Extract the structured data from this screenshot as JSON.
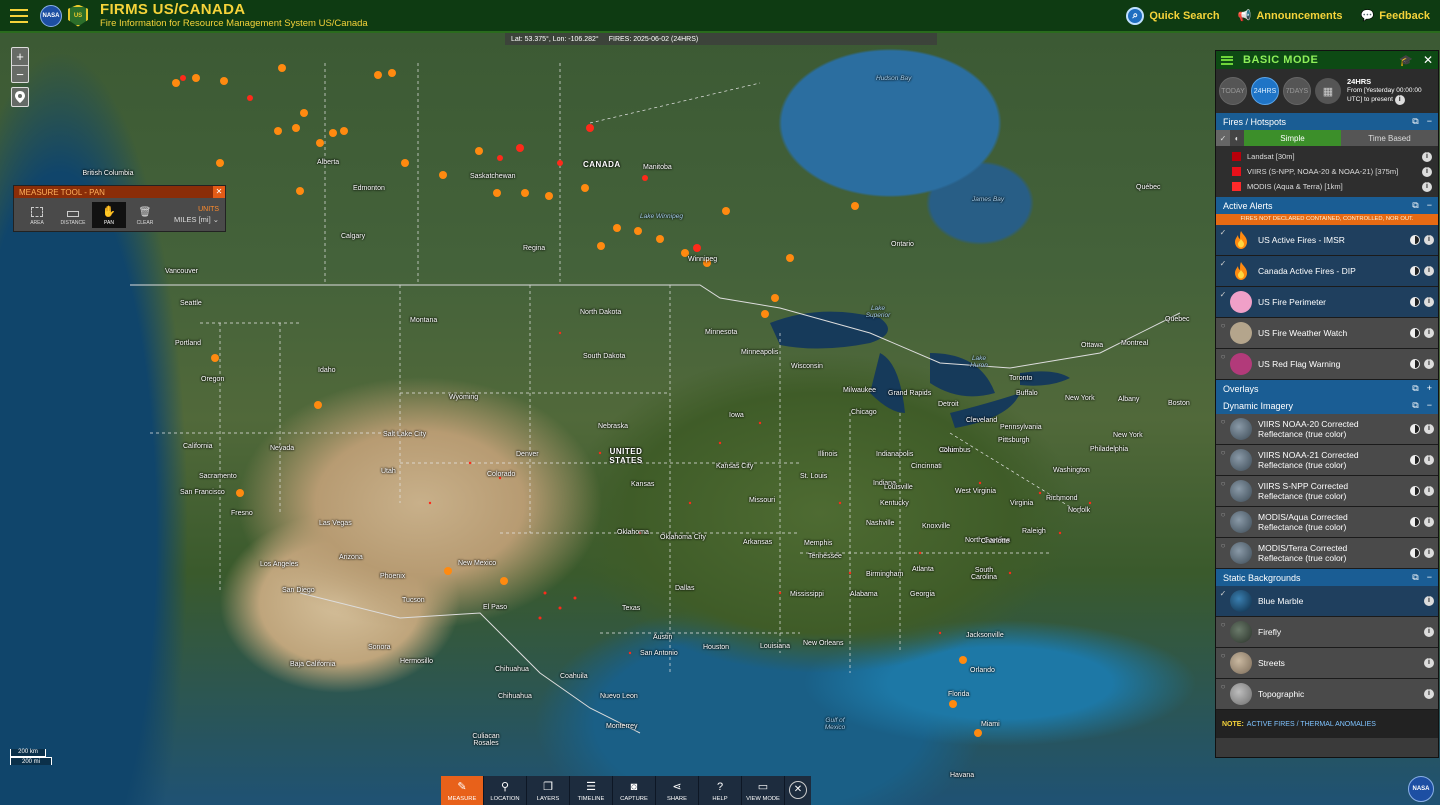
{
  "header": {
    "title": "FIRMS US/CANADA",
    "subtitle": "Fire Information for Resource Management System US/Canada",
    "quick_search": "Quick Search",
    "announcements": "Announcements",
    "feedback": "Feedback"
  },
  "coord_bar": {
    "latlon": "Lat: 53.375°, Lon: -106.282°",
    "fires": "FIRES: 2025-06-02 (24HRS)"
  },
  "zoom": {
    "in": "+",
    "out": "−"
  },
  "scale": {
    "km": "200 km",
    "mi": "200 mi"
  },
  "measure_tool": {
    "title": "MEASURE TOOL - PAN",
    "close": "✕",
    "buttons": [
      "AREA",
      "DISTANCE",
      "PAN",
      "CLEAR"
    ],
    "active": "PAN",
    "units_label": "UNITS",
    "units_value": "MILES [mi]"
  },
  "panel": {
    "mode": "BASIC MODE",
    "time_buttons": [
      "TODAY",
      "24HRS",
      "7DAYS"
    ],
    "active_time": "24HRS",
    "time_info": {
      "title": "24HRS",
      "line1": "From [Yesterday 00:00:00",
      "line2": "UTC] to present"
    },
    "fires_section": {
      "title": "Fires / Hotspots",
      "tabs": [
        "Simple",
        "Time Based"
      ],
      "legend": [
        {
          "label": "Landsat [30m]",
          "color": "#b8000a"
        },
        {
          "label": "VIIRS (S-NPP, NOAA-20 & NOAA-21) [375m]",
          "color": "#e8101a"
        },
        {
          "label": "MODIS (Aqua & Terra) [1km]",
          "color": "#ff2a2a"
        }
      ]
    },
    "alerts_section": {
      "title": "Active Alerts",
      "banner": "FIRES NOT DECLARED CONTAINED, CONTROLLED, NOR OUT.",
      "layers": [
        {
          "label": "US Active Fires - IMSR",
          "on": true
        },
        {
          "label": "Canada Active Fires - DIP",
          "on": true
        },
        {
          "label": "US Fire Perimeter",
          "on": true
        },
        {
          "label": "US Fire Weather Watch",
          "on": false
        },
        {
          "label": "US Red Flag Warning",
          "on": false
        }
      ]
    },
    "overlays_title": "Overlays",
    "dynamic_section": {
      "title": "Dynamic Imagery",
      "layers": [
        {
          "line1": "VIIRS NOAA-20 Corrected",
          "line2": "Reflectance (true color)"
        },
        {
          "line1": "VIIRS NOAA-21 Corrected",
          "line2": "Reflectance (true color)"
        },
        {
          "line1": "VIIRS S-NPP Corrected",
          "line2": "Reflectance (true color)"
        },
        {
          "line1": "MODIS/Aqua Corrected",
          "line2": "Reflectance (true color)"
        },
        {
          "line1": "MODIS/Terra Corrected",
          "line2": "Reflectance (true color)"
        }
      ]
    },
    "static_section": {
      "title": "Static Backgrounds",
      "layers": [
        {
          "label": "Blue Marble",
          "on": true
        },
        {
          "label": "Firefly",
          "on": false
        },
        {
          "label": "Streets",
          "on": false
        },
        {
          "label": "Topographic",
          "on": false
        }
      ]
    },
    "note": {
      "key": "NOTE:",
      "value": "ACTIVE FIRES / THERMAL ANOMALIES"
    }
  },
  "toolbar": {
    "buttons": [
      "MEASURE",
      "LOCATION",
      "LAYERS",
      "TIMELINE",
      "CAPTURE",
      "SHARE",
      "HELP",
      "VIEW MODE"
    ],
    "active": "MEASURE",
    "close": "✕"
  },
  "logos": {
    "nasa": "NASA",
    "usfs": "US"
  },
  "map_labels": {
    "countries": [
      "CANADA",
      "UNITED STATES"
    ],
    "regions": [
      "British Columbia",
      "Alberta",
      "Saskatchewan",
      "Manitoba",
      "Ontario",
      "Québec",
      "Montana",
      "North Dakota",
      "South Dakota",
      "Minnesota",
      "Wisconsin",
      "Iowa",
      "Nebraska",
      "Wyoming",
      "Idaho",
      "Oregon",
      "Nevada",
      "Utah",
      "Colorado",
      "Kansas",
      "Missouri",
      "Illinois",
      "Indiana",
      "Ohio",
      "Kentucky",
      "Tennessee",
      "Arkansas",
      "Oklahoma",
      "Texas",
      "New Mexico",
      "Arizona",
      "Mississippi",
      "Alabama",
      "Georgia",
      "Louisiana",
      "Florida",
      "Virginia",
      "West Virginia",
      "North Carolina",
      "South Carolina",
      "New York",
      "Pennsylvania",
      "California",
      "Baja California",
      "Sonora",
      "Chihuahua",
      "Coahuila",
      "Nuevo Leon"
    ],
    "cities": [
      "Vancouver",
      "Seattle",
      "Portland",
      "Calgary",
      "Edmonton",
      "Regina",
      "Winnipeg",
      "Sacramento",
      "San Francisco",
      "Fresno",
      "Las Vegas",
      "Los Angeles",
      "San Diego",
      "Phoenix",
      "Tucson",
      "El Paso",
      "Salt Lake City",
      "Denver",
      "Kansas City",
      "Oklahoma City",
      "Dallas",
      "Austin",
      "San Antonio",
      "Houston",
      "New Orleans",
      "Memphis",
      "St. Louis",
      "Chicago",
      "Milwaukee",
      "Minneapolis",
      "Detroit",
      "Toronto",
      "Ottawa",
      "Montreal",
      "Buffalo",
      "Boston",
      "Albany",
      "New York",
      "Philadelphia",
      "Washington",
      "Pittsburgh",
      "Columbus",
      "Indianapolis",
      "Cincinnati",
      "Louisville",
      "Nashville",
      "Knoxville",
      "Birmingham",
      "Atlanta",
      "Charlotte",
      "Raleigh",
      "Richmond",
      "Norfolk",
      "Jacksonville",
      "Orlando",
      "Miami",
      "Havana",
      "Monterrey",
      "Hermosillo",
      "Chihuahua",
      "Culiacan Rosales",
      "Quebec",
      "Cleveland",
      "Grand Rapids"
    ],
    "waters": [
      "Hudson Bay",
      "James Bay",
      "Lake Superior",
      "Lake Huron",
      "Lake Winnipeg",
      "Gulf of Mexico"
    ]
  }
}
